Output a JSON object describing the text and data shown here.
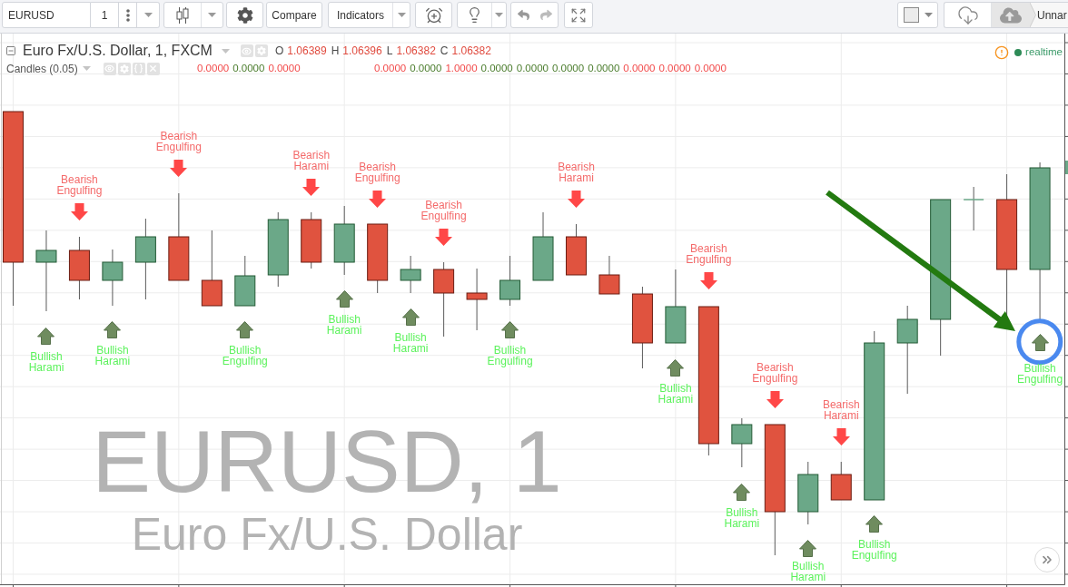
{
  "toolbar": {
    "symbol": {
      "value": "EURUSD"
    },
    "interval": "1",
    "compare": "Compare",
    "indicators": "Indicators",
    "layout_name": "Unnar"
  },
  "legend": {
    "title": "Euro Fx/U.S. Dollar, 1, FXCM",
    "ohlc": [
      {
        "label": "O",
        "value": "1.06389"
      },
      {
        "label": "H",
        "value": "1.06396"
      },
      {
        "label": "L",
        "value": "1.06382"
      },
      {
        "label": "C",
        "value": "1.06382"
      }
    ],
    "indicator": {
      "name": "Candles (0.05)",
      "value_groups": [
        [
          {
            "text": "0.0000",
            "color": "#f24a4a"
          },
          {
            "text": "0.0000",
            "color": "#4a7c2c"
          },
          {
            "text": "0.0000",
            "color": "#f24a4a"
          }
        ],
        [
          {
            "text": "0.0000",
            "color": "#f24a4a"
          },
          {
            "text": "0.0000",
            "color": "#4a7c2c"
          },
          {
            "text": "1.0000",
            "color": "#f24a4a"
          },
          {
            "text": "0.0000",
            "color": "#4a7c2c"
          },
          {
            "text": "0.0000",
            "color": "#4a7c2c"
          },
          {
            "text": "0.0000",
            "color": "#4a7c2c"
          },
          {
            "text": "0.0000",
            "color": "#4a7c2c"
          },
          {
            "text": "0.0000",
            "color": "#f24a4a"
          },
          {
            "text": "0.0000",
            "color": "#f24a4a"
          },
          {
            "text": "0.0000",
            "color": "#f24a4a"
          }
        ]
      ]
    },
    "status": "realtime"
  },
  "watermark": {
    "symbol": "EURUSD, 1",
    "description": "Euro Fx/U.S. Dollar"
  },
  "patterns": [
    {
      "kind": "bullish",
      "label": "Bullish Harami"
    },
    {
      "kind": "bearish",
      "label": "Bearish Engulfing"
    },
    {
      "kind": "bullish",
      "label": "Bullish Harami"
    },
    {
      "kind": "bearish",
      "label": "Bearish Engulfing"
    },
    {
      "kind": "bullish",
      "label": "Bullish Engulfing"
    },
    {
      "kind": "bearish",
      "label": "Bearish Harami"
    },
    {
      "kind": "bullish",
      "label": "Bullish Harami"
    },
    {
      "kind": "bearish",
      "label": "Bearish Engulfing"
    },
    {
      "kind": "bullish",
      "label": "Bullish Harami"
    },
    {
      "kind": "bearish",
      "label": "Bearish Engulfing"
    },
    {
      "kind": "bullish",
      "label": "Bullish Engulfing"
    },
    {
      "kind": "bearish",
      "label": "Bearish Harami"
    },
    {
      "kind": "bullish",
      "label": "Bullish Harami"
    },
    {
      "kind": "bearish",
      "label": "Bearish Engulfing"
    },
    {
      "kind": "bullish",
      "label": "Bullish Harami"
    },
    {
      "kind": "bearish",
      "label": "Bearish Engulfing"
    },
    {
      "kind": "bullish",
      "label": "Bullish Harami"
    },
    {
      "kind": "bearish",
      "label": "Bearish Harami"
    },
    {
      "kind": "bullish",
      "label": "Bullish Engulfing"
    },
    {
      "kind": "bullish",
      "label": "Bullish Engulfing"
    }
  ]
}
